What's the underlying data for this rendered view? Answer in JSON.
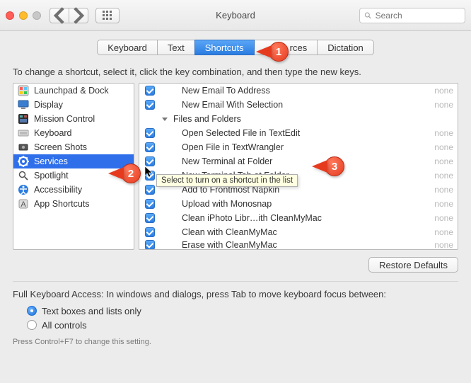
{
  "window": {
    "title": "Keyboard"
  },
  "search": {
    "placeholder": "Search"
  },
  "tabs": [
    "Keyboard",
    "Text",
    "Shortcuts",
    "Input Sources",
    "Dictation"
  ],
  "active_tab_index": 2,
  "instruction": "To change a shortcut, select it, click the key combination, and then type the new keys.",
  "categories": [
    {
      "label": "Launchpad & Dock",
      "icon": "launchpad"
    },
    {
      "label": "Display",
      "icon": "display"
    },
    {
      "label": "Mission Control",
      "icon": "mission"
    },
    {
      "label": "Keyboard",
      "icon": "keyboard"
    },
    {
      "label": "Screen Shots",
      "icon": "screenshots"
    },
    {
      "label": "Services",
      "icon": "services"
    },
    {
      "label": "Spotlight",
      "icon": "spotlight"
    },
    {
      "label": "Accessibility",
      "icon": "accessibility"
    },
    {
      "label": "App Shortcuts",
      "icon": "app"
    }
  ],
  "selected_category_index": 5,
  "items": [
    {
      "type": "child",
      "checked": true,
      "label": "New Email To Address",
      "shortcut": "none"
    },
    {
      "type": "child",
      "checked": true,
      "label": "New Email With Selection",
      "shortcut": "none"
    },
    {
      "type": "group",
      "label": "Files and Folders"
    },
    {
      "type": "child",
      "checked": true,
      "label": "Open Selected File in TextEdit",
      "shortcut": "none"
    },
    {
      "type": "child",
      "checked": true,
      "label": "Open File in TextWrangler",
      "shortcut": "none"
    },
    {
      "type": "child",
      "checked": true,
      "label": "New Terminal at Folder",
      "shortcut": "none"
    },
    {
      "type": "child",
      "checked": true,
      "label": "New Terminal Tab at Folder",
      "shortcut": "none"
    },
    {
      "type": "child",
      "checked": true,
      "label": "Add to Frontmost Napkin",
      "shortcut": "none"
    },
    {
      "type": "child",
      "checked": true,
      "label": "Upload with Monosnap",
      "shortcut": "none"
    },
    {
      "type": "child",
      "checked": true,
      "label": "Clean iPhoto Libr…ith CleanMyMac",
      "shortcut": "none"
    },
    {
      "type": "child",
      "checked": true,
      "label": "Clean with CleanMyMac",
      "shortcut": "none"
    },
    {
      "type": "child",
      "checked": true,
      "label": "Erase with CleanMyMac",
      "shortcut": "none"
    }
  ],
  "tooltip": "Select to turn on a shortcut in the list",
  "restore_button": "Restore Defaults",
  "full_access": {
    "label": "Full Keyboard Access: In windows and dialogs, press Tab to move keyboard focus between:",
    "options": [
      "Text boxes and lists only",
      "All controls"
    ],
    "selected": 0,
    "hint": "Press Control+F7 to change this setting."
  },
  "callouts": {
    "1": "1",
    "2": "2",
    "3": "3"
  }
}
